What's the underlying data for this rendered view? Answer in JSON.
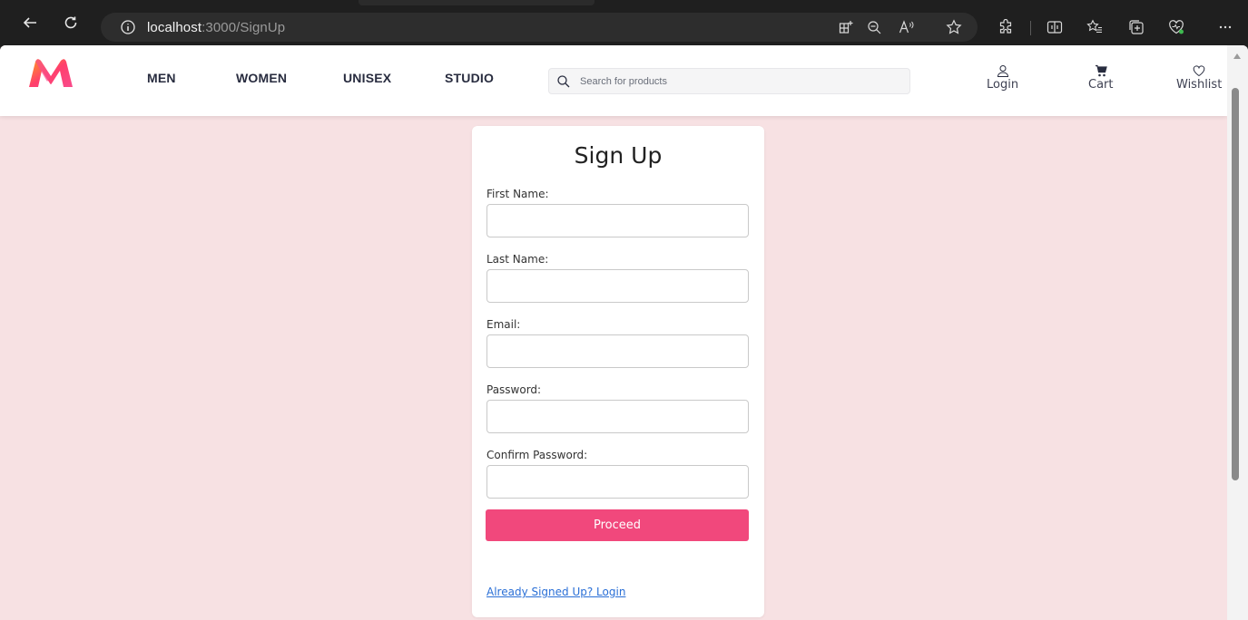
{
  "browser": {
    "url_host": "localhost",
    "url_path": ":3000/SignUp"
  },
  "navbar": {
    "links": [
      "MEN",
      "WOMEN",
      "UNISEX",
      "STUDIO"
    ],
    "search_placeholder": "Search for products",
    "login_label": "Login",
    "cart_label": "Cart",
    "wishlist_label": "Wishlist",
    "brand_colors": [
      "#ff3f6c",
      "#f94b8b",
      "#ff9e1b"
    ]
  },
  "form": {
    "title": "Sign Up",
    "fields": [
      {
        "label": "First Name:",
        "value": ""
      },
      {
        "label": "Last Name:",
        "value": ""
      },
      {
        "label": "Email:",
        "value": ""
      },
      {
        "label": "Password:",
        "value": ""
      },
      {
        "label": "Confirm Password:",
        "value": ""
      }
    ],
    "submit_label": "Proceed",
    "login_link": "Already Signed Up? Login"
  },
  "colors": {
    "page_background": "#f7e1e3",
    "accent": "#f1487c",
    "link": "#2a6fd6"
  }
}
